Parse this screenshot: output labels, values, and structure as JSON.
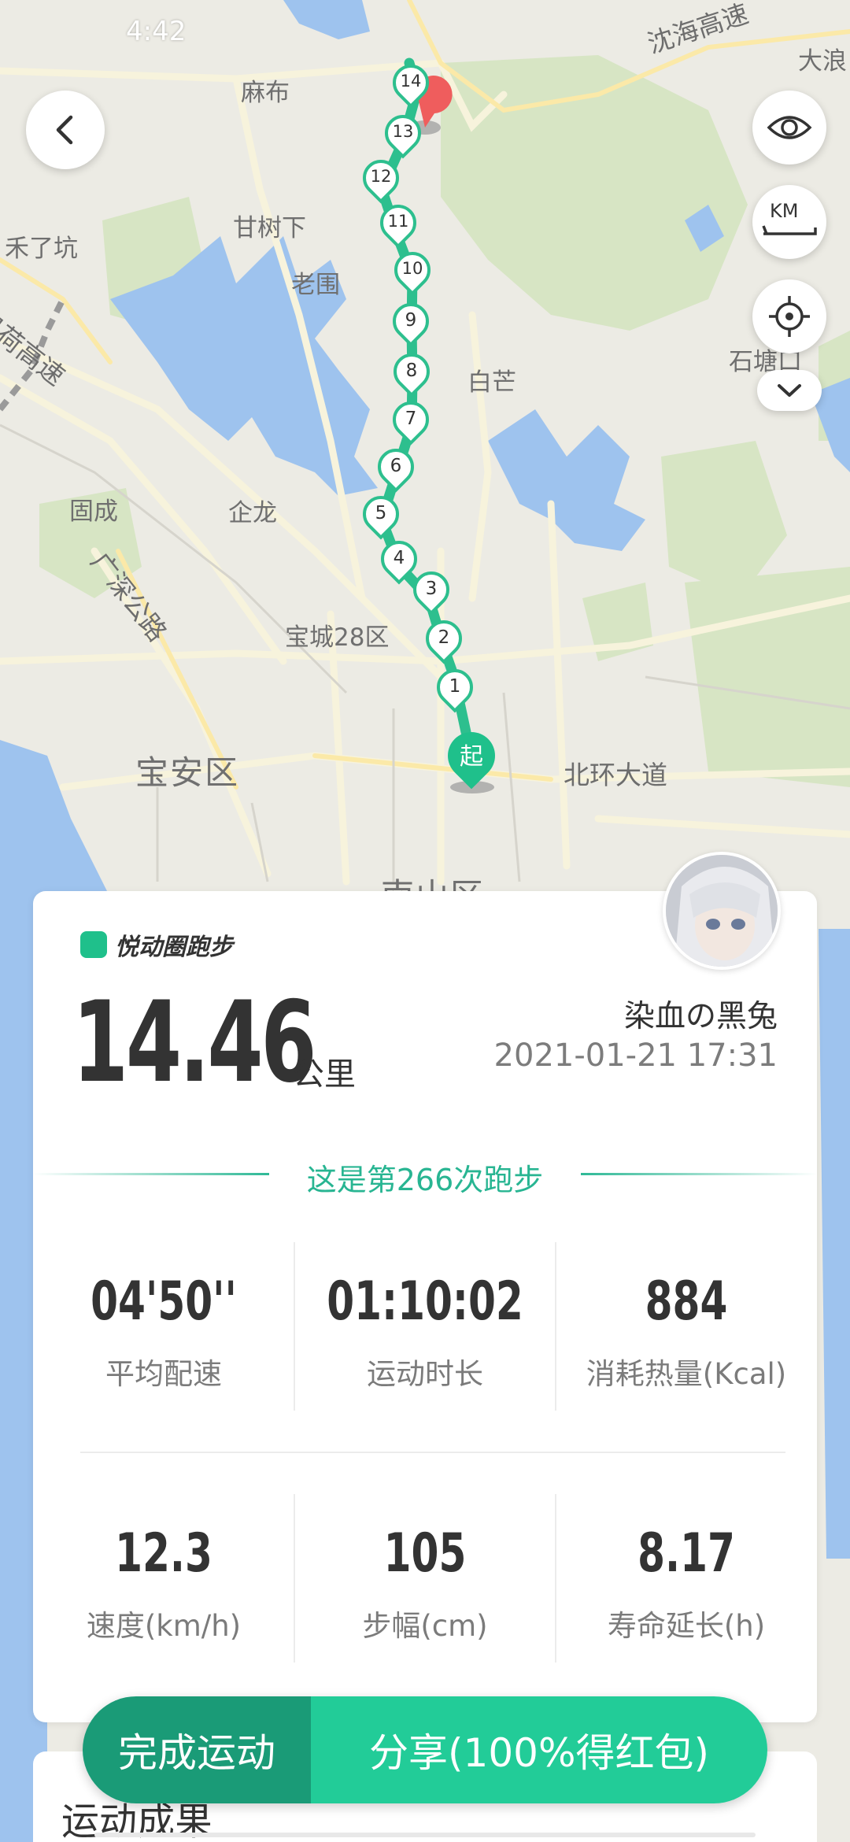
{
  "status_bar": {
    "time": "4:42"
  },
  "map": {
    "labels": {
      "mabu": "麻布",
      "ganshuxia": "甘树下",
      "laowei": "老围",
      "heliaokeng": "禾了坑",
      "baimang": "白芒",
      "shitangkou": "石塘口",
      "gucheng": "固成",
      "qilong": "企龙",
      "baocheng28": "宝城28区",
      "baoan": "宝安区",
      "nanshan": "南山区",
      "beihuan": "北环大道",
      "rendong": "广深公路",
      "yanhai": "沈海高速",
      "jihao": "机荷高速",
      "dalang": "大浪"
    },
    "markers": [
      "1",
      "2",
      "3",
      "4",
      "5",
      "6",
      "7",
      "8",
      "9",
      "10",
      "11",
      "12",
      "13",
      "14"
    ],
    "start_label": "起",
    "route_color": "#2dbf8e"
  },
  "controls": {
    "back": "back",
    "eye": "eye",
    "km": "KM",
    "locate": "locate",
    "collapse": "collapse"
  },
  "card": {
    "brand": "悦动圈跑步",
    "distance": "14.46",
    "distance_unit": "公里",
    "username": "染血の黑兔",
    "datetime": "2021-01-21 17:31",
    "run_count": "这是第266次跑步",
    "stats": [
      {
        "value": "04'50''",
        "label": "平均配速"
      },
      {
        "value": "01:10:02",
        "label": "运动时长"
      },
      {
        "value": "884",
        "label": "消耗热量(Kcal)"
      },
      {
        "value": "12.3",
        "label": "速度(km/h)"
      },
      {
        "value": "105",
        "label": "步幅(cm)"
      },
      {
        "value": "8.17",
        "label": "寿命延长(h)"
      }
    ]
  },
  "bottom": {
    "achievement_title": "运动成果",
    "finish_button": "完成运动",
    "share_button": "分享(100%得红包)"
  },
  "colors": {
    "accent": "#22cc98",
    "accent_dark": "#1a9b77",
    "water": "#9cc1ec",
    "green_area": "#d6e4c2"
  }
}
